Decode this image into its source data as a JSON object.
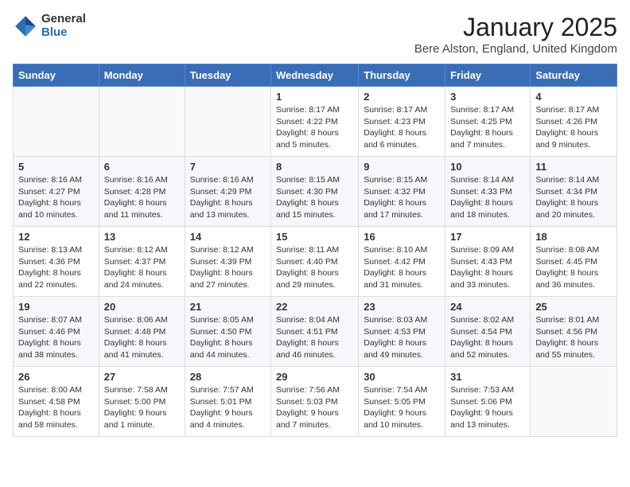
{
  "logo": {
    "general": "General",
    "blue": "Blue"
  },
  "header": {
    "title": "January 2025",
    "subtitle": "Bere Alston, England, United Kingdom"
  },
  "weekdays": [
    "Sunday",
    "Monday",
    "Tuesday",
    "Wednesday",
    "Thursday",
    "Friday",
    "Saturday"
  ],
  "weeks": [
    [
      {
        "day": "",
        "info": ""
      },
      {
        "day": "",
        "info": ""
      },
      {
        "day": "",
        "info": ""
      },
      {
        "day": "1",
        "info": "Sunrise: 8:17 AM\nSunset: 4:22 PM\nDaylight: 8 hours and 5 minutes."
      },
      {
        "day": "2",
        "info": "Sunrise: 8:17 AM\nSunset: 4:23 PM\nDaylight: 8 hours and 6 minutes."
      },
      {
        "day": "3",
        "info": "Sunrise: 8:17 AM\nSunset: 4:25 PM\nDaylight: 8 hours and 7 minutes."
      },
      {
        "day": "4",
        "info": "Sunrise: 8:17 AM\nSunset: 4:26 PM\nDaylight: 8 hours and 9 minutes."
      }
    ],
    [
      {
        "day": "5",
        "info": "Sunrise: 8:16 AM\nSunset: 4:27 PM\nDaylight: 8 hours and 10 minutes."
      },
      {
        "day": "6",
        "info": "Sunrise: 8:16 AM\nSunset: 4:28 PM\nDaylight: 8 hours and 11 minutes."
      },
      {
        "day": "7",
        "info": "Sunrise: 8:16 AM\nSunset: 4:29 PM\nDaylight: 8 hours and 13 minutes."
      },
      {
        "day": "8",
        "info": "Sunrise: 8:15 AM\nSunset: 4:30 PM\nDaylight: 8 hours and 15 minutes."
      },
      {
        "day": "9",
        "info": "Sunrise: 8:15 AM\nSunset: 4:32 PM\nDaylight: 8 hours and 17 minutes."
      },
      {
        "day": "10",
        "info": "Sunrise: 8:14 AM\nSunset: 4:33 PM\nDaylight: 8 hours and 18 minutes."
      },
      {
        "day": "11",
        "info": "Sunrise: 8:14 AM\nSunset: 4:34 PM\nDaylight: 8 hours and 20 minutes."
      }
    ],
    [
      {
        "day": "12",
        "info": "Sunrise: 8:13 AM\nSunset: 4:36 PM\nDaylight: 8 hours and 22 minutes."
      },
      {
        "day": "13",
        "info": "Sunrise: 8:12 AM\nSunset: 4:37 PM\nDaylight: 8 hours and 24 minutes."
      },
      {
        "day": "14",
        "info": "Sunrise: 8:12 AM\nSunset: 4:39 PM\nDaylight: 8 hours and 27 minutes."
      },
      {
        "day": "15",
        "info": "Sunrise: 8:11 AM\nSunset: 4:40 PM\nDaylight: 8 hours and 29 minutes."
      },
      {
        "day": "16",
        "info": "Sunrise: 8:10 AM\nSunset: 4:42 PM\nDaylight: 8 hours and 31 minutes."
      },
      {
        "day": "17",
        "info": "Sunrise: 8:09 AM\nSunset: 4:43 PM\nDaylight: 8 hours and 33 minutes."
      },
      {
        "day": "18",
        "info": "Sunrise: 8:08 AM\nSunset: 4:45 PM\nDaylight: 8 hours and 36 minutes."
      }
    ],
    [
      {
        "day": "19",
        "info": "Sunrise: 8:07 AM\nSunset: 4:46 PM\nDaylight: 8 hours and 38 minutes."
      },
      {
        "day": "20",
        "info": "Sunrise: 8:06 AM\nSunset: 4:48 PM\nDaylight: 8 hours and 41 minutes."
      },
      {
        "day": "21",
        "info": "Sunrise: 8:05 AM\nSunset: 4:50 PM\nDaylight: 8 hours and 44 minutes."
      },
      {
        "day": "22",
        "info": "Sunrise: 8:04 AM\nSunset: 4:51 PM\nDaylight: 8 hours and 46 minutes."
      },
      {
        "day": "23",
        "info": "Sunrise: 8:03 AM\nSunset: 4:53 PM\nDaylight: 8 hours and 49 minutes."
      },
      {
        "day": "24",
        "info": "Sunrise: 8:02 AM\nSunset: 4:54 PM\nDaylight: 8 hours and 52 minutes."
      },
      {
        "day": "25",
        "info": "Sunrise: 8:01 AM\nSunset: 4:56 PM\nDaylight: 8 hours and 55 minutes."
      }
    ],
    [
      {
        "day": "26",
        "info": "Sunrise: 8:00 AM\nSunset: 4:58 PM\nDaylight: 8 hours and 58 minutes."
      },
      {
        "day": "27",
        "info": "Sunrise: 7:58 AM\nSunset: 5:00 PM\nDaylight: 9 hours and 1 minute."
      },
      {
        "day": "28",
        "info": "Sunrise: 7:57 AM\nSunset: 5:01 PM\nDaylight: 9 hours and 4 minutes."
      },
      {
        "day": "29",
        "info": "Sunrise: 7:56 AM\nSunset: 5:03 PM\nDaylight: 9 hours and 7 minutes."
      },
      {
        "day": "30",
        "info": "Sunrise: 7:54 AM\nSunset: 5:05 PM\nDaylight: 9 hours and 10 minutes."
      },
      {
        "day": "31",
        "info": "Sunrise: 7:53 AM\nSunset: 5:06 PM\nDaylight: 9 hours and 13 minutes."
      },
      {
        "day": "",
        "info": ""
      }
    ]
  ]
}
